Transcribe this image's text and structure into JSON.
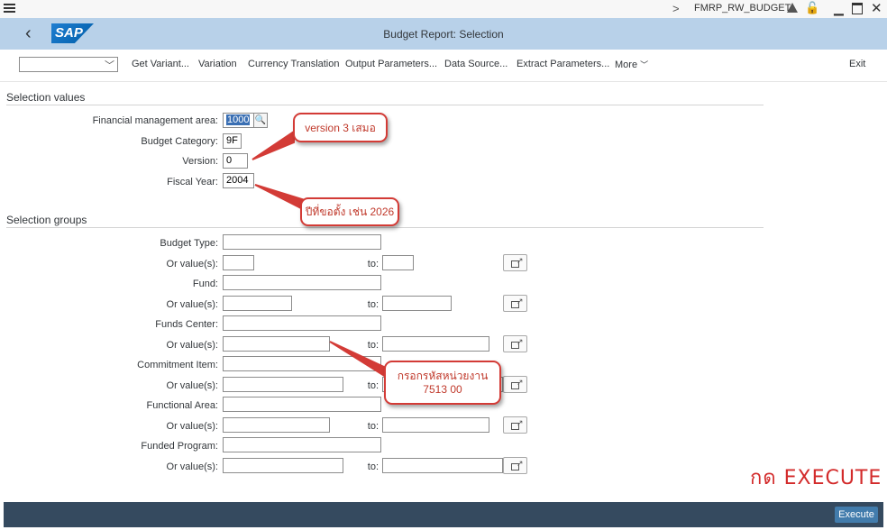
{
  "system_bar": {
    "menu_icon": "hamburger-menu-icon",
    "chevron": ">",
    "system_name": "FMRP_RW_BUDGET",
    "icons": [
      "triangle-icon",
      "lock-icon",
      "minimize-icon",
      "maximize-icon",
      "close-icon"
    ]
  },
  "header": {
    "back_icon": "‹",
    "logo_text": "SAP",
    "title": "Budget Report: Selection"
  },
  "toolbar": {
    "variant_value": "",
    "buttons": [
      "Get Variant...",
      "Variation",
      "Currency Translation",
      "Output Parameters...",
      "Data Source...",
      "Extract Parameters..."
    ],
    "more_label": "More",
    "exit_label": "Exit"
  },
  "selection_values": {
    "title": "Selection values",
    "fm_area": {
      "label": "Financial management area:",
      "value": "1000"
    },
    "budget_category": {
      "label": "Budget Category:",
      "value": "9F"
    },
    "version": {
      "label": "Version:",
      "value": "0"
    },
    "fiscal_year": {
      "label": "Fiscal Year:",
      "value": "2004"
    }
  },
  "selection_groups": {
    "title": "Selection groups",
    "or_label": "Or value(s):",
    "to_label": "to:",
    "items": [
      {
        "label": "Budget Type:"
      },
      {
        "label": "Fund:"
      },
      {
        "label": "Funds Center:"
      },
      {
        "label": "Commitment Item:"
      },
      {
        "label": "Functional Area:"
      },
      {
        "label": "Funded Program:"
      }
    ]
  },
  "annotations": {
    "version_note": "version 3 เสมอ",
    "year_note": "ปีที่ขอตั้ง เช่น 2026",
    "fund_center_note_line1": "กรอกรหัสหน่วยงาน",
    "fund_center_note_line2": "7513 00",
    "execute_note": "กด EXECUTE",
    "accent_color": "#d33b36"
  },
  "footer": {
    "execute_label": "Execute"
  }
}
